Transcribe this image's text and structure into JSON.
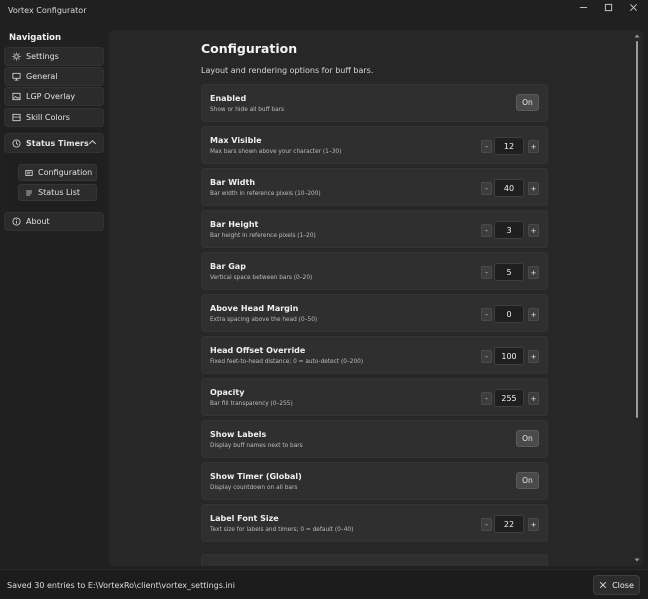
{
  "window": {
    "title": "Vortex Configurator",
    "controls": [
      "minimize-icon",
      "maximize-icon",
      "close-icon"
    ]
  },
  "sidebar": {
    "heading": "Navigation",
    "items": [
      {
        "label": "Settings",
        "icon": "gear-icon"
      },
      {
        "label": "General",
        "icon": "monitor-icon"
      },
      {
        "label": "LGP Overlay",
        "icon": "image-icon"
      },
      {
        "label": "Skill Colors",
        "icon": "palette-icon"
      }
    ],
    "group": {
      "label": "Status Timers",
      "icon": "clock-icon",
      "expanded": true,
      "children": [
        {
          "label": "Configuration",
          "icon": "sliders-icon",
          "selected": true
        },
        {
          "label": "Status List",
          "icon": "list-icon"
        }
      ]
    },
    "about": {
      "label": "About",
      "icon": "info-icon"
    }
  },
  "main": {
    "title": "Configuration",
    "subtitle": "Layout and rendering options for buff bars.",
    "settings": [
      {
        "label": "Enabled",
        "description": "Show or hide all buff bars",
        "type": "toggle",
        "value": "On"
      },
      {
        "label": "Max Visible",
        "description": "Max bars shown above your character (1–30)",
        "type": "stepper",
        "value": "12"
      },
      {
        "label": "Bar Width",
        "description": "Bar width in reference pixels (10–200)",
        "type": "stepper",
        "value": "40"
      },
      {
        "label": "Bar Height",
        "description": "Bar height in reference pixels (1–20)",
        "type": "stepper",
        "value": "3"
      },
      {
        "label": "Bar Gap",
        "description": "Vertical space between bars (0–20)",
        "type": "stepper",
        "value": "5"
      },
      {
        "label": "Above Head Margin",
        "description": "Extra spacing above the head (0–50)",
        "type": "stepper",
        "value": "0"
      },
      {
        "label": "Head Offset Override",
        "description": "Fixed feet-to-head distance; 0 = auto-detect (0–200)",
        "type": "stepper",
        "value": "100"
      },
      {
        "label": "Opacity",
        "description": "Bar fill transparency (0–255)",
        "type": "stepper",
        "value": "255"
      },
      {
        "label": "Show Labels",
        "description": "Display buff names next to bars",
        "type": "toggle",
        "value": "On"
      },
      {
        "label": "Show Timer (Global)",
        "description": "Display countdown on all bars",
        "type": "toggle",
        "value": "On"
      },
      {
        "label": "Label Font Size",
        "description": "Text size for labels and timers; 0 = default (0–40)",
        "type": "stepper",
        "value": "22"
      }
    ],
    "stepper_minus": "-",
    "stepper_plus": "+"
  },
  "statusbar": {
    "message": "Saved 30 entries to E:\\VortexRo\\client\\vortex_settings.ini",
    "close_label": "Close"
  },
  "colors": {
    "background": "#202020",
    "panel": "#272727",
    "card": "#2f2f2f",
    "toggle": "#4a4a4a"
  }
}
